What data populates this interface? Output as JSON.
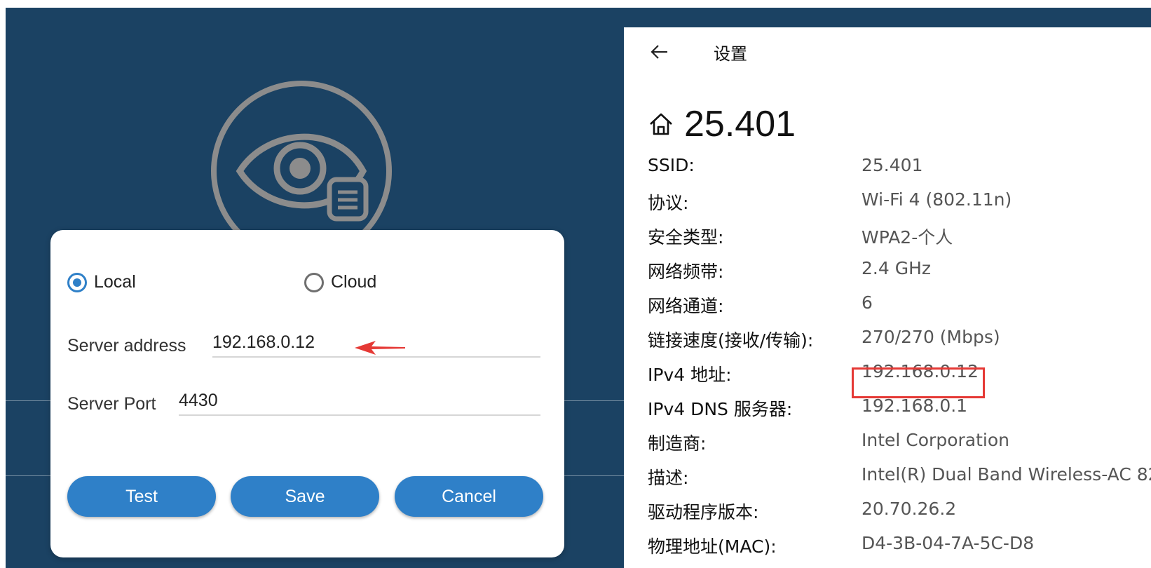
{
  "dialog": {
    "mode_options": [
      {
        "label": "Local",
        "checked": true
      },
      {
        "label": "Cloud",
        "checked": false
      }
    ],
    "server_address_label": "Server address",
    "server_address_value": "192.168.0.12",
    "server_port_label": "Server Port",
    "server_port_value": "4430",
    "buttons": {
      "test": "Test",
      "save": "Save",
      "cancel": "Cancel"
    }
  },
  "settings": {
    "title": "设置",
    "network_name": "25.401",
    "properties": [
      {
        "key": "SSID:",
        "value": "25.401"
      },
      {
        "key": "协议:",
        "value": "Wi-Fi 4 (802.11n)"
      },
      {
        "key": "安全类型:",
        "value": "WPA2-个人"
      },
      {
        "key": "网络频带:",
        "value": "2.4 GHz"
      },
      {
        "key": "网络通道:",
        "value": "6"
      },
      {
        "key": "链接速度(接收/传输):",
        "value": "270/270 (Mbps)"
      },
      {
        "key": "IPv4 地址:",
        "value": "192.168.0.12"
      },
      {
        "key": "IPv4 DNS 服务器:",
        "value": "192.168.0.1"
      },
      {
        "key": "制造商:",
        "value": "Intel Corporation"
      },
      {
        "key": "描述:",
        "value": "Intel(R) Dual Band Wireless-AC 82"
      },
      {
        "key": "驱动程序版本:",
        "value": "20.70.26.2"
      },
      {
        "key": "物理地址(MAC):",
        "value": "D4-3B-04-7A-5C-D8"
      }
    ]
  },
  "colors": {
    "app_background": "#1b4263",
    "accent": "#2f80c8",
    "annotation_red": "#e53935"
  },
  "icons": [
    "app-logo-eye-document-icon",
    "back-arrow-icon",
    "home-icon",
    "red-arrow-annotation-icon"
  ]
}
